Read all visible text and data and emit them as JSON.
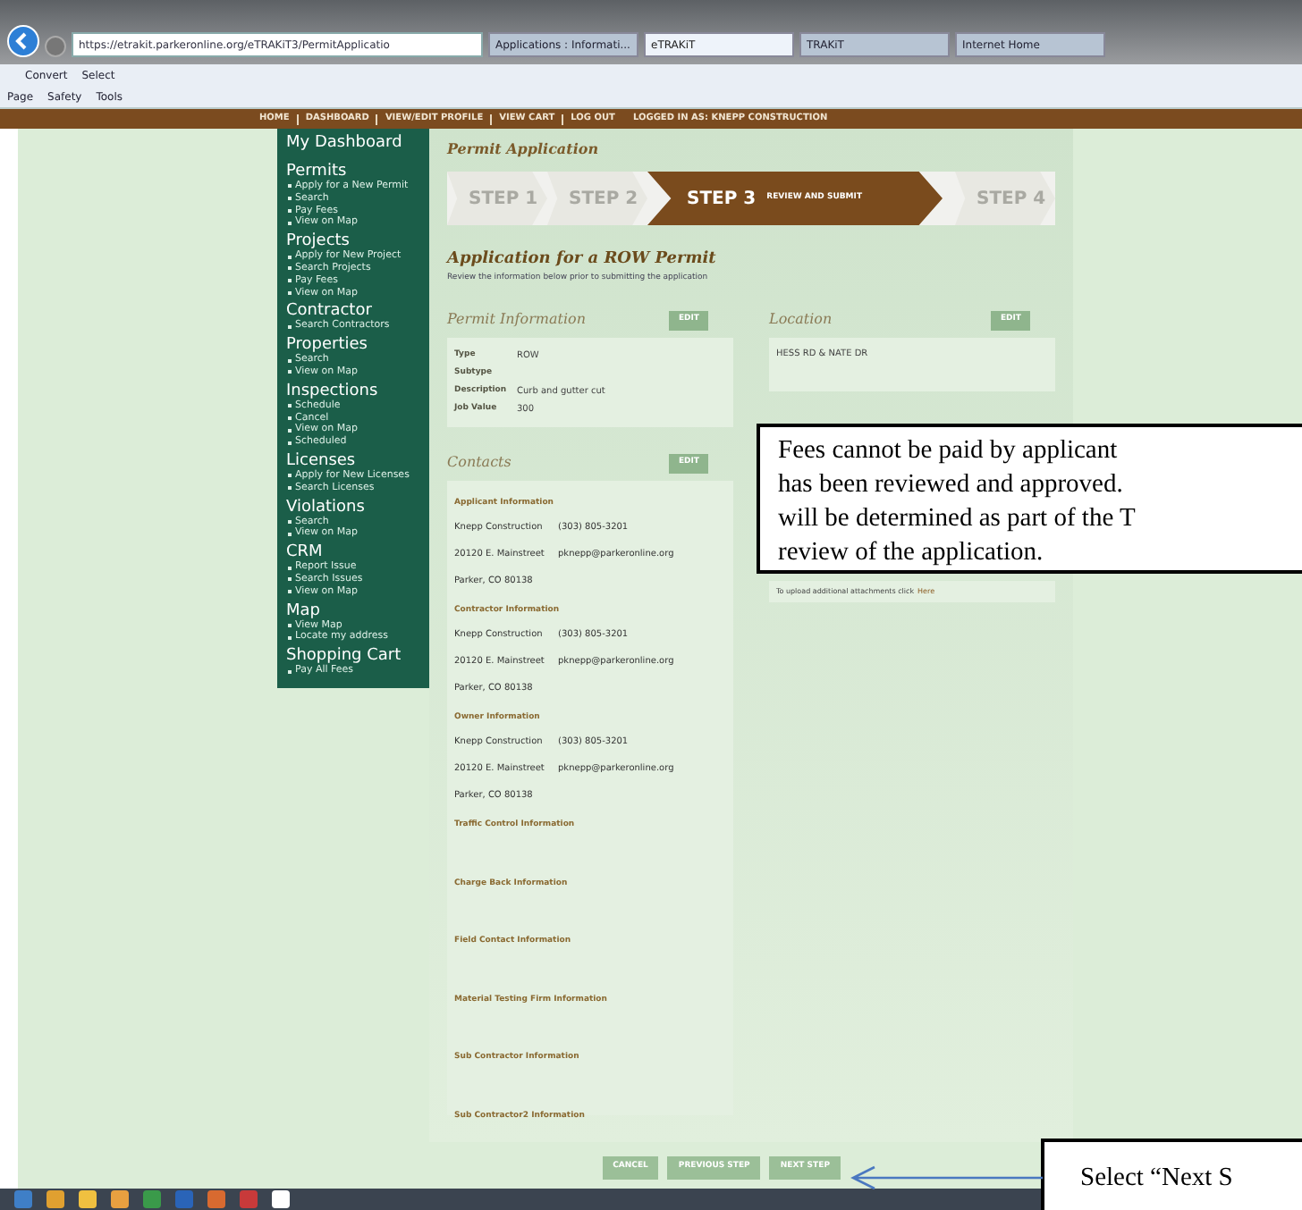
{
  "browser": {
    "address": "https://etrakit.parkeronline.org/eTRAKiT3/PermitApplicatio",
    "tabs": [
      {
        "label": "Applications : Informati...",
        "selected": false
      },
      {
        "label": "eTRAKiT",
        "selected": true
      },
      {
        "label": "TRAKiT",
        "selected": false
      },
      {
        "label": "Internet Home",
        "selected": false
      }
    ],
    "toolbar_1": [
      "Convert",
      "Select"
    ],
    "toolbar_2": [
      "Page",
      "Safety",
      "Tools"
    ]
  },
  "nav": {
    "links": [
      "HOME",
      "DASHBOARD",
      "VIEW/EDIT PROFILE",
      "VIEW CART",
      "LOG OUT"
    ],
    "logged_in": "LOGGED IN AS: KNEPP CONSTRUCTION"
  },
  "sidebar": [
    {
      "heading": "My Dashboard"
    },
    {
      "heading": "Permits",
      "items": [
        "Apply for a New Permit",
        "Search",
        "Pay Fees",
        "View on Map"
      ]
    },
    {
      "heading": "Projects",
      "items": [
        "Apply for New Project",
        "Search Projects",
        "Pay Fees",
        "View on Map"
      ]
    },
    {
      "heading": "Contractor",
      "items": [
        "Search Contractors"
      ]
    },
    {
      "heading": "Properties",
      "items": [
        "Search",
        "View on Map"
      ]
    },
    {
      "heading": "Inspections",
      "items": [
        "Schedule",
        "Cancel",
        "View on Map",
        "Scheduled"
      ]
    },
    {
      "heading": "Licenses",
      "items": [
        "Apply for New Licenses",
        "Search Licenses"
      ]
    },
    {
      "heading": "Violations",
      "items": [
        "Search",
        "View on Map"
      ]
    },
    {
      "heading": "CRM",
      "items": [
        "Report Issue",
        "Search Issues",
        "View on Map"
      ]
    },
    {
      "heading": "Map",
      "items": [
        "View Map",
        "Locate my address"
      ]
    },
    {
      "heading": "Shopping Cart",
      "items": [
        "Pay All Fees"
      ]
    }
  ],
  "page_title": "Permit Application",
  "steps": [
    {
      "label": "STEP 1",
      "selected": false
    },
    {
      "label": "STEP 2",
      "selected": false
    },
    {
      "label": "STEP 3",
      "sublabel": "REVIEW AND SUBMIT",
      "selected": true
    },
    {
      "label": "STEP 4",
      "selected": false
    }
  ],
  "application_title": "Application for a ROW Permit",
  "application_subtitle": "Review the information below prior to submitting the application",
  "permit_information": {
    "title": "Permit Information",
    "edit": "EDIT",
    "fields": [
      {
        "label": "Type",
        "value": "ROW"
      },
      {
        "label": "Subtype"
      },
      {
        "label": "Description",
        "value": "Curb and gutter cut"
      },
      {
        "label": "Job Value",
        "value": "300"
      }
    ]
  },
  "location": {
    "title": "Location",
    "edit": "EDIT",
    "address": "HESS RD & NATE DR"
  },
  "attachments": {
    "text": "To upload additional attachments click",
    "link": "Here"
  },
  "contacts": {
    "title": "Contacts",
    "edit": "EDIT",
    "groups": [
      {
        "heading": "Applicant Information",
        "lines": [
          [
            "Knepp Construction",
            "(303) 805-3201"
          ],
          [
            "20120 E. Mainstreet",
            "pknepp@parkeronline.org"
          ],
          [
            "Parker, CO 80138"
          ]
        ]
      },
      {
        "heading": "Contractor Information",
        "lines": [
          [
            "Knepp Construction",
            "(303) 805-3201"
          ],
          [
            "20120 E. Mainstreet",
            "pknepp@parkeronline.org"
          ],
          [
            "Parker, CO 80138"
          ]
        ]
      },
      {
        "heading": "Owner Information",
        "lines": [
          [
            "Knepp Construction",
            "(303) 805-3201"
          ],
          [
            "20120 E. Mainstreet",
            "pknepp@parkeronline.org"
          ],
          [
            "Parker, CO 80138"
          ]
        ]
      },
      {
        "heading": "Traffic Control Information"
      },
      {
        "heading": "Charge Back Information"
      },
      {
        "heading": "Field Contact Information"
      },
      {
        "heading": "Material Testing Firm Information"
      },
      {
        "heading": "Sub Contractor Information"
      },
      {
        "heading": "Sub Contractor2 Information"
      }
    ]
  },
  "buttons": [
    "CANCEL",
    "PREVIOUS STEP",
    "NEXT STEP"
  ],
  "callouts": [
    {
      "lines": [
        "Fees cannot be paid by applicant",
        "has been reviewed and approved.",
        "will be determined as part of the T",
        "review of the application."
      ]
    },
    {
      "lines": [
        "Select “Next S"
      ]
    }
  ]
}
